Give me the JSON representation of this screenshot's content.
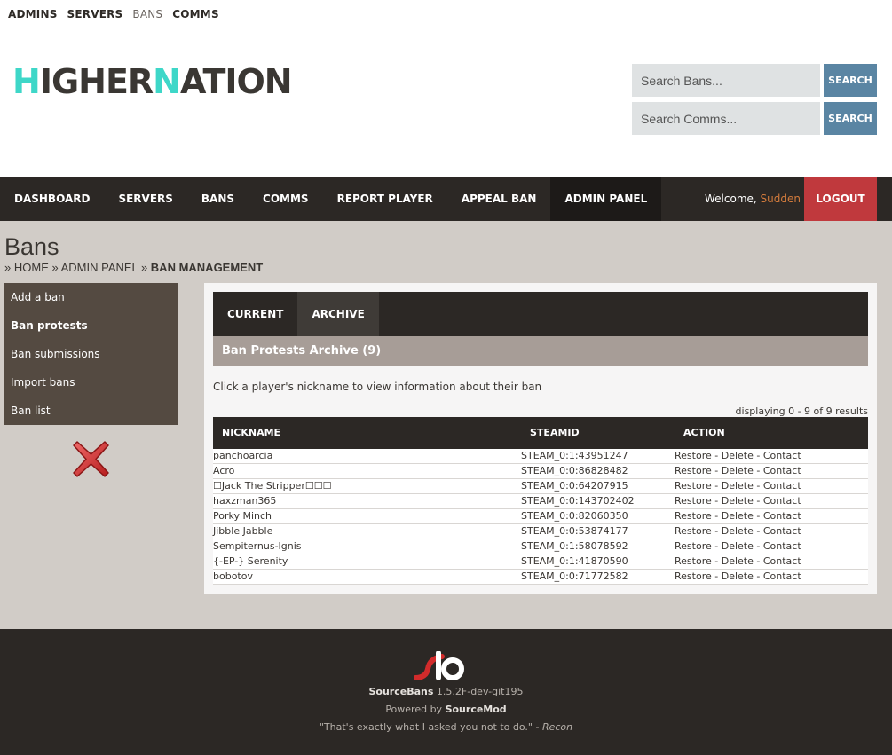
{
  "toplinks": [
    {
      "label": "ADMINS"
    },
    {
      "label": "SERVERS"
    },
    {
      "label": "BANS"
    },
    {
      "label": "COMMS"
    }
  ],
  "logo": {
    "part1": "H",
    "part2": "IGHER",
    "part3": "N",
    "part4": "ATION"
  },
  "search": {
    "bans_placeholder": "Search Bans...",
    "comms_placeholder": "Search Comms...",
    "button_label": "SEARCH"
  },
  "nav": {
    "items": [
      "DASHBOARD",
      "SERVERS",
      "BANS",
      "COMMS",
      "REPORT PLAYER",
      "APPEAL BAN",
      "ADMIN PANEL"
    ],
    "welcome_prefix": "Welcome,",
    "username": "Sudden",
    "logout": "LOGOUT"
  },
  "page": {
    "title": "Bans",
    "breadcrumb": [
      "HOME",
      "ADMIN PANEL",
      "BAN MANAGEMENT"
    ]
  },
  "sidebar": {
    "items": [
      "Add a ban",
      "Ban protests",
      "Ban submissions",
      "Import bans",
      "Ban list"
    ]
  },
  "panel": {
    "tabs": [
      "CURRENT",
      "ARCHIVE"
    ],
    "archive_heading": "Ban Protests Archive (9)",
    "hint": "Click a player's nickname to view information about their ban",
    "displaying": "displaying 0 - 9 of 9 results",
    "columns": [
      "NICKNAME",
      "STEAMID",
      "ACTION"
    ],
    "action_restore": "Restore",
    "action_delete": "Delete",
    "action_contact": "Contact",
    "action_sep": " - ",
    "rows": [
      {
        "nickname": "panchoarcia",
        "steamid": "STEAM_0:1:43951247"
      },
      {
        "nickname": "Acro",
        "steamid": "STEAM_0:0:86828482"
      },
      {
        "nickname": "☐Jack The Stripper☐☐☐",
        "steamid": "STEAM_0:0:64207915"
      },
      {
        "nickname": "haxzman365",
        "steamid": "STEAM_0:0:143702402"
      },
      {
        "nickname": "Porky Minch",
        "steamid": "STEAM_0:0:82060350"
      },
      {
        "nickname": "Jibble Jabble",
        "steamid": "STEAM_0:0:53874177"
      },
      {
        "nickname": "Sempiternus-Ignis",
        "steamid": "STEAM_0:1:58078592"
      },
      {
        "nickname": "{-EP-} Serenity",
        "steamid": "STEAM_0:1:41870590"
      },
      {
        "nickname": "bobotov",
        "steamid": "STEAM_0:0:71772582"
      }
    ]
  },
  "footer": {
    "app_name": "SourceBans",
    "version": "1.5.2F-dev-git195",
    "powered_prefix": "Powered by",
    "powered_name": "SourceMod",
    "quote": "\"That's exactly what I asked you not to do.\"",
    "quote_sep": " - ",
    "quote_author": "Recon"
  },
  "colors": {
    "nav_bg": "#2c2825",
    "accent_teal": "#3ed7c8",
    "search_button": "#5a85a3",
    "logout_red": "#c0393d",
    "username_orange": "#d37b3c",
    "content_bg": "#d1ccc7",
    "sidebar_bg": "#544a41"
  }
}
